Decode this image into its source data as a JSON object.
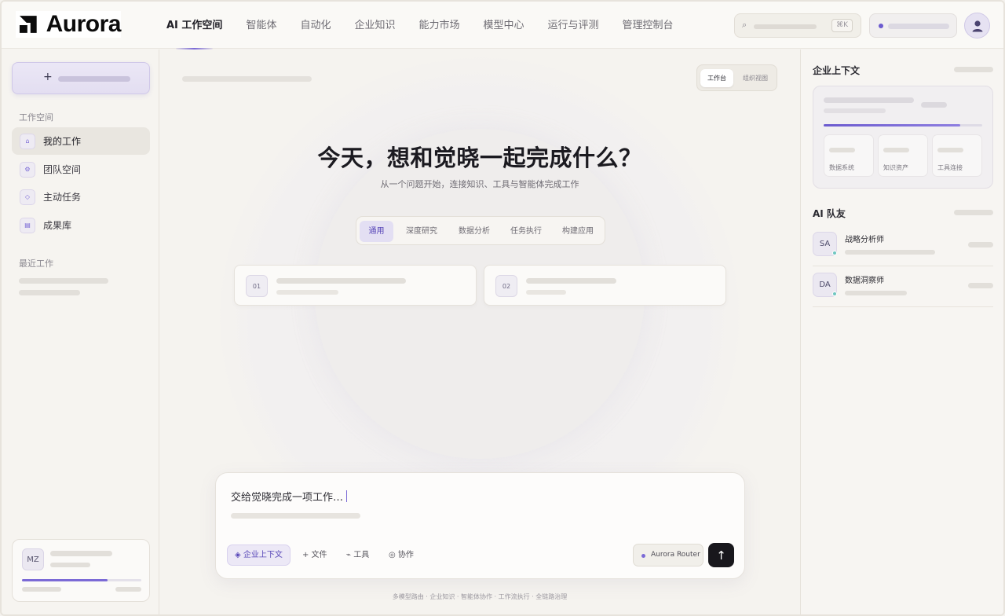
{
  "app": {
    "brand": "Aurora"
  },
  "nav": {
    "items": [
      {
        "label": "AI 工作空间",
        "active": true
      },
      {
        "label": "智能体",
        "active": false
      },
      {
        "label": "自动化",
        "active": false
      },
      {
        "label": "企业知识",
        "active": false
      },
      {
        "label": "能力市场",
        "active": false
      },
      {
        "label": "模型中心",
        "active": false
      },
      {
        "label": "运行与评测",
        "active": false
      },
      {
        "label": "管理控制台",
        "active": false
      }
    ],
    "search": {
      "icon": "search-icon",
      "shortcut": "⌘K"
    }
  },
  "sidebar": {
    "new_icon": "+",
    "section_workspace": "工作空间",
    "items": [
      {
        "label": "我的工作",
        "icon": "home-icon",
        "active": true
      },
      {
        "label": "团队空间",
        "icon": "team-icon",
        "active": false
      },
      {
        "label": "主动任务",
        "icon": "task-icon",
        "active": false
      },
      {
        "label": "成果库",
        "icon": "library-icon",
        "active": false
      }
    ],
    "section_recent": "最近工作",
    "user": {
      "initials": "MZ",
      "progress": 0.72
    }
  },
  "main": {
    "view_toggle": {
      "active": "工作台",
      "inactive": "组织视图"
    },
    "headline": "今天，想和觉晓一起完成什么？",
    "subline": "从一个问题开始，连接知识、工具与智能体完成工作",
    "modes": [
      "通用",
      "深度研究",
      "数据分析",
      "任务执行",
      "构建应用"
    ],
    "active_mode": "通用",
    "cards": [
      {
        "number": "01"
      },
      {
        "number": "02"
      }
    ],
    "composer": {
      "placeholder": "交给觉晓完成一项工作…",
      "chips": [
        "◈ 企业上下文",
        "+ 文件",
        "⌁ 工具",
        "◎ 协作"
      ],
      "router": "Aurora Router",
      "send_icon": "↑"
    },
    "footer": "多模型路由 · 企业知识 · 智能体协作 · 工作流执行 · 全链路治理"
  },
  "right": {
    "context_title": "企业上下文",
    "context_progress": 0.86,
    "tiles": [
      "数据系统",
      "知识资产",
      "工具连接"
    ],
    "team_title": "AI 队友",
    "teammates": [
      {
        "initials": "SA",
        "name": "战略分析师"
      },
      {
        "initials": "DA",
        "name": "数据洞察师"
      }
    ]
  },
  "colors": {
    "accent": "#7b6ad6",
    "accent_soft": "#e3dff3",
    "send": "#18171c",
    "online": "#6fc6c0"
  }
}
